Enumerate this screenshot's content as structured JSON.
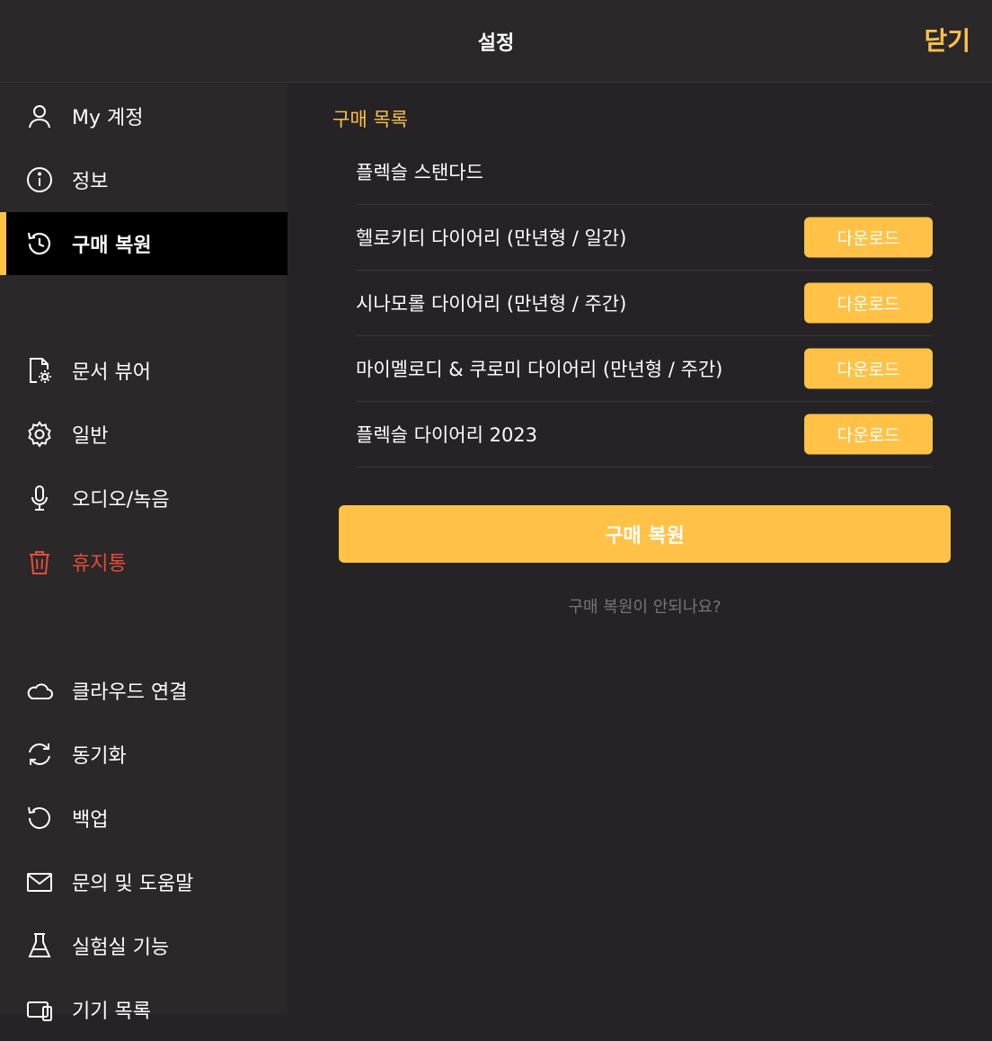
{
  "header": {
    "title": "설정",
    "close_label": "닫기"
  },
  "sidebar": {
    "items": [
      {
        "label": "My 계정",
        "icon": "user-icon"
      },
      {
        "label": "정보",
        "icon": "info-icon"
      },
      {
        "label": "구매 복원",
        "icon": "history-icon",
        "active": true
      },
      {
        "label": "문서 뷰어",
        "icon": "document-settings-icon"
      },
      {
        "label": "일반",
        "icon": "gear-icon"
      },
      {
        "label": "오디오/녹음",
        "icon": "microphone-icon"
      },
      {
        "label": "휴지통",
        "icon": "trash-icon"
      },
      {
        "label": "클라우드 연결",
        "icon": "cloud-icon"
      },
      {
        "label": "동기화",
        "icon": "sync-icon"
      },
      {
        "label": "백업",
        "icon": "backup-icon"
      },
      {
        "label": "문의 및 도움말",
        "icon": "mail-icon"
      },
      {
        "label": "실험실 기능",
        "icon": "flask-icon"
      },
      {
        "label": "기기 목록",
        "icon": "devices-icon"
      }
    ]
  },
  "main": {
    "section_title": "구매 목록",
    "purchases": [
      {
        "name": "플렉슬 스탠다드",
        "button": ""
      },
      {
        "name": "헬로키티 다이어리 (만년형 / 일간)",
        "button": "다운로드"
      },
      {
        "name": "시나모롤 다이어리 (만년형 / 주간)",
        "button": "다운로드"
      },
      {
        "name": "마이멜로디 & 쿠로미 다이어리 (만년형 / 주간)",
        "button": "다운로드"
      },
      {
        "name": "플렉슬 다이어리 2023",
        "button": "다운로드"
      }
    ],
    "restore_button": "구매 복원",
    "help_link": "구매 복원이 안되나요?"
  },
  "colors": {
    "accent": "#ffc247",
    "danger": "#e74c3c",
    "background": "#252325",
    "sidebar": "#2a2829"
  }
}
